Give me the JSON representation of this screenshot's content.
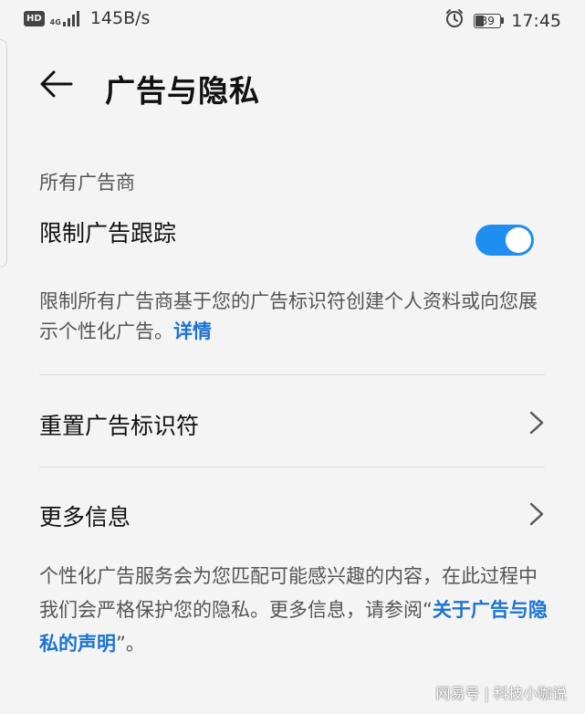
{
  "status_bar": {
    "hd": "HD",
    "network_type": "4G",
    "speed": "145B/s",
    "battery": "39",
    "time": "17:45"
  },
  "header": {
    "title": "广告与隐私",
    "back_icon": "arrow-left-icon"
  },
  "section": {
    "label": "所有广告商"
  },
  "limit_tracking": {
    "label": "限制广告跟踪",
    "enabled": true,
    "toggle_color": "#1e8ff0"
  },
  "description": {
    "text": "限制所有广告商基于您的广告标识符创建个人资料或向您展示个性化广告。",
    "link": "详情"
  },
  "rows": {
    "reset_ad_id": "重置广告标识符",
    "more_info": "更多信息"
  },
  "footer": {
    "text_before": "个性化广告服务会为您匹配可能感兴趣的内容，在此过程中我们会严格保护您的隐私。更多信息，请参阅“",
    "link": "关于广告与隐私的声明",
    "text_after": "”。"
  },
  "watermark": "网易号 | 科技小咖说",
  "colors": {
    "accent": "#1e8ff0",
    "link": "#1d73d4",
    "background": "#f4f4f4"
  }
}
